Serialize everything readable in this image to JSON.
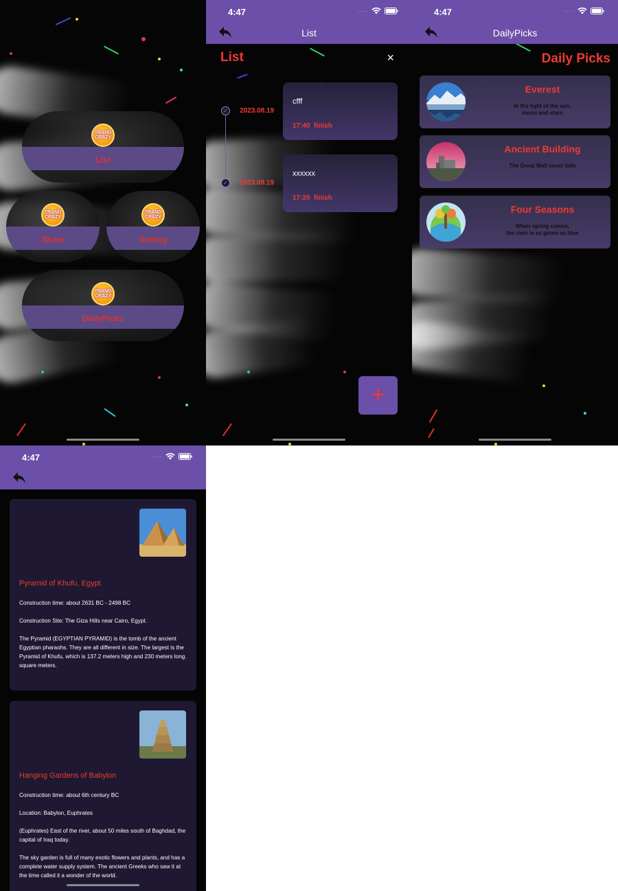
{
  "statusbar": {
    "time": "4:47"
  },
  "screen1": {
    "logo_top": "TRAND",
    "logo_bottom": "CRAZY",
    "items": [
      {
        "label": "List"
      },
      {
        "label": "Share"
      },
      {
        "label": "Setting"
      },
      {
        "label": "DailyPicks"
      }
    ]
  },
  "screen2": {
    "nav_title": "List",
    "heading": "List",
    "close_label": "×",
    "add_label": "+",
    "tasks": [
      {
        "date": "2023.08.19",
        "name": "cfff",
        "time": "17:40",
        "status": "finish"
      },
      {
        "date": "2023.08.19",
        "name": "xxxxxx",
        "time": "17:20",
        "status": "finish"
      }
    ]
  },
  "screen3": {
    "nav_title": "DailyPicks",
    "heading": "Daily Picks",
    "picks": [
      {
        "title": "Everest",
        "desc": "In the light of the sun,\nmoon and stars"
      },
      {
        "title": "Ancient Building",
        "desc": "The Great Wall never falls"
      },
      {
        "title": "Four Seasons",
        "desc": "When spring comes,\nthe river is as green as blue"
      }
    ]
  },
  "screen4": {
    "wonders": [
      {
        "title": "Pyramid of Khufu, Egypt",
        "p1": "Construction time: about 2631 BC - 2498 BC",
        "p2": "Construction Site: The Giza Hills near Cairo, Egypt.",
        "p3": "The Pyramid (EGYPTIAN PYRAMID) is the tomb of the ancient Egyptian pharaohs. They are all different in size. The largest is the Pyramid of Khufu, which is 137.2 meters high and 230 meters long. square meters."
      },
      {
        "title": "Hanging Gardens of Babylon",
        "p1": "Construction time: about 6th century BC",
        "p2": "Location: Babylon, Euphrates",
        "p3": "(Euphrates) East of the river, about 50 miles south of Baghdad, the capital of Iraq today.",
        "p4": "The sky garden is full of many exotic flowers and plants, and has a complete water supply system. The ancient Greeks who saw it at the time called it a wonder of the world."
      }
    ]
  }
}
